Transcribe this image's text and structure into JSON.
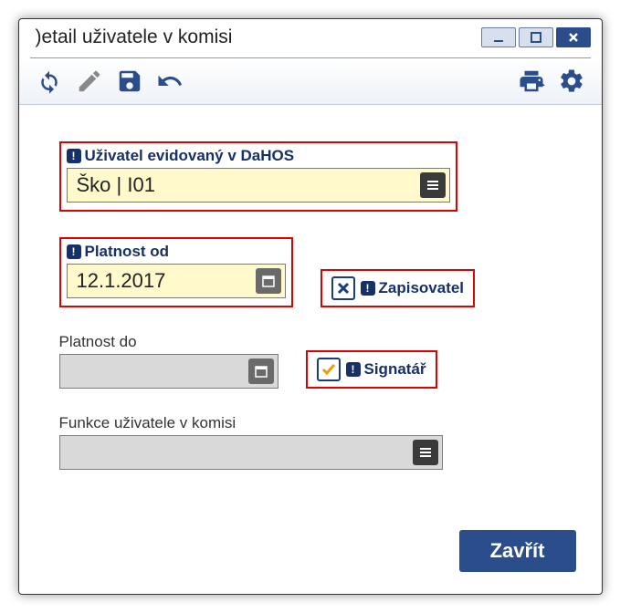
{
  "window": {
    "title": ")etail uživatele v komisi"
  },
  "fields": {
    "user": {
      "label": "Uživatel evidovaný v DaHOS",
      "value": "Ško | I01"
    },
    "validFrom": {
      "label": "Platnost od",
      "value": "12.1.2017"
    },
    "validTo": {
      "label": "Platnost do",
      "value": ""
    },
    "function": {
      "label": "Funkce uživatele v komisi",
      "value": ""
    },
    "recorder": {
      "label": "Zapisovatel",
      "checked": false
    },
    "signatory": {
      "label": "Signatář",
      "checked": true
    }
  },
  "buttons": {
    "close": "Zavřít"
  }
}
